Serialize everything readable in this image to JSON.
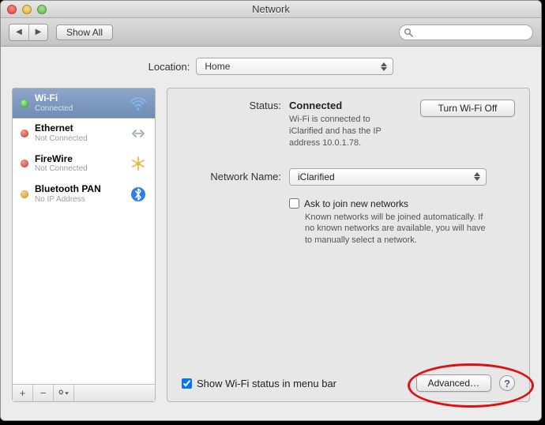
{
  "window": {
    "title": "Network"
  },
  "toolbar": {
    "back": "◀",
    "forward": "▶",
    "showall": "Show All",
    "search_placeholder": ""
  },
  "location": {
    "label": "Location:",
    "value": "Home"
  },
  "sidebar": {
    "items": [
      {
        "name": "Wi-Fi",
        "sub": "Connected",
        "dot": "green",
        "icon": "wifi"
      },
      {
        "name": "Ethernet",
        "sub": "Not Connected",
        "dot": "red",
        "icon": "ethernet"
      },
      {
        "name": "FireWire",
        "sub": "Not Connected",
        "dot": "red",
        "icon": "firewire"
      },
      {
        "name": "Bluetooth PAN",
        "sub": "No IP Address",
        "dot": "orange",
        "icon": "bluetooth"
      }
    ],
    "footer": {
      "add": "+",
      "remove": "−",
      "action": "✻▾"
    }
  },
  "main": {
    "status_label": "Status:",
    "status_value": "Connected",
    "status_desc": "Wi-Fi is connected to iClarified and has the IP address 10.0.1.78.",
    "turnoff_btn": "Turn Wi-Fi Off",
    "networkname_label": "Network Name:",
    "networkname_value": "iClarified",
    "ask_label": "Ask to join new networks",
    "ask_desc": "Known networks will be joined automatically. If no known networks are available, you will have to manually select a network.",
    "menubar_label": "Show Wi-Fi status in menu bar",
    "advanced_btn": "Advanced…",
    "help": "?"
  }
}
